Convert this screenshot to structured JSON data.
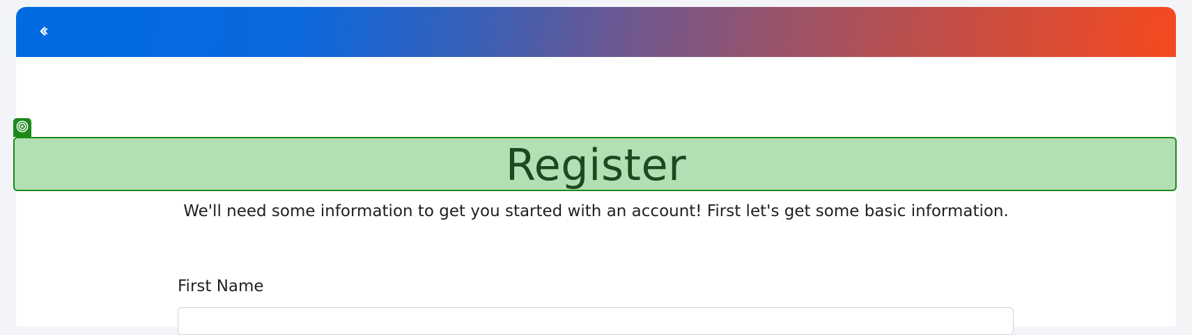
{
  "header": {
    "back_icon": "chevron-left-icon",
    "gradient_colors": [
      "#006ae0",
      "#f54a1f"
    ]
  },
  "highlight": {
    "badge_icon": "target-icon",
    "color": "#1b8a1b",
    "fill": "#b3dfb4"
  },
  "main": {
    "title": "Register",
    "subtitle": "We'll need some information to get you started with an account! First let's get some basic information."
  },
  "form": {
    "first_name": {
      "label": "First Name",
      "value": "",
      "placeholder": ""
    }
  }
}
